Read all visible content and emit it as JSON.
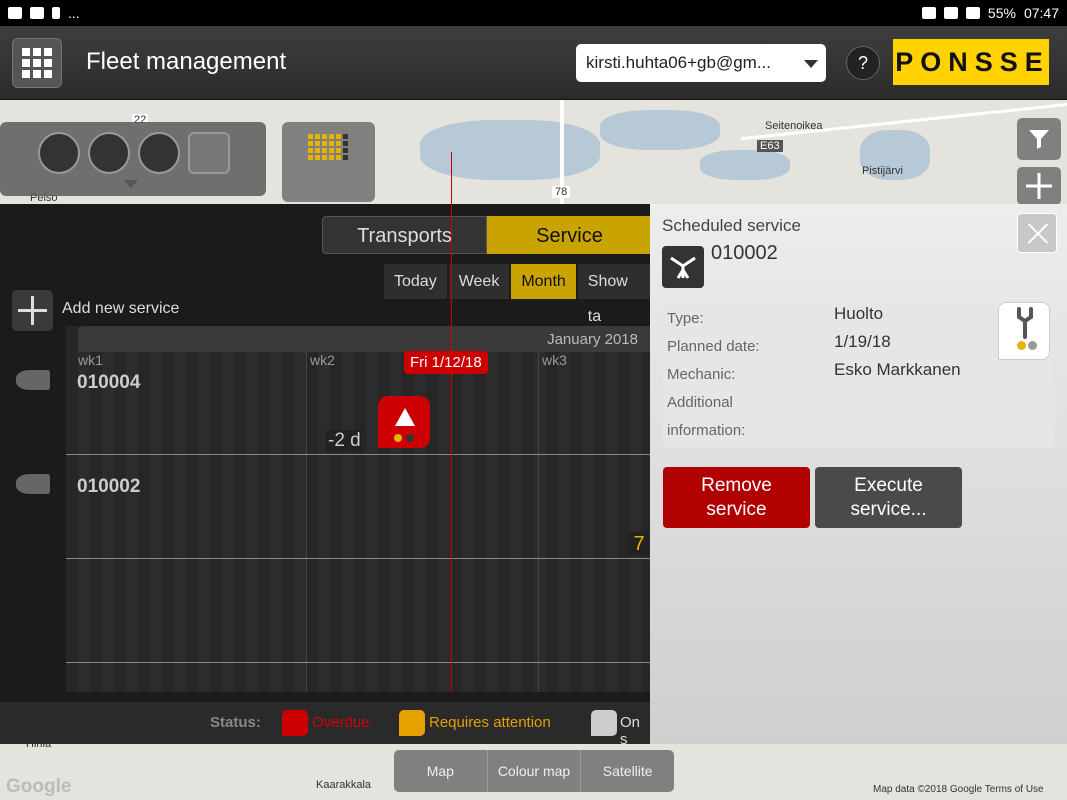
{
  "status_bar": {
    "ellipsis": "...",
    "battery": "55%",
    "time": "07:47"
  },
  "app": {
    "title": "Fleet management",
    "account": "kirsti.huhta06+gb@gm...",
    "help": "?",
    "logo_letters": [
      "P",
      "O",
      "N",
      "S",
      "S",
      "E"
    ]
  },
  "map": {
    "labels": {
      "pelso": "Pelso",
      "seitenoikea": "Seitenoikea",
      "e63": "E63",
      "pistijarvi": "Pistijärvi",
      "r78": "78",
      "r22": "22",
      "karakkala": "Kaarakkala",
      "hirila": "Hirilä"
    },
    "toggles": [
      "Map",
      "Colour map",
      "Satellite"
    ],
    "google": "Google",
    "attribution": "Map data ©2018 Google   Terms of Use"
  },
  "panel": {
    "mode_tabs": [
      "Transports",
      "Service"
    ],
    "range_tabs": [
      "Today",
      "Week",
      "Month",
      "Show ta"
    ],
    "add_label": "Add new service",
    "month": "January 2018",
    "weeks": [
      "wk1",
      "wk2",
      "wk3"
    ],
    "rows": [
      "010004",
      "010002"
    ],
    "today_tag": "Fri 1/12/18",
    "delta": "-2 d",
    "count": "7",
    "legend": {
      "label": "Status:",
      "overdue": "Overdue",
      "attention": "Requires attention",
      "on_schedule": "On s"
    }
  },
  "detail": {
    "title": "Scheduled service",
    "machine_id": "010002",
    "fields": {
      "type_label": "Type:",
      "type_value": "Huolto",
      "date_label": "Planned date:",
      "date_value": "1/19/18",
      "mechanic_label": "Mechanic:",
      "mechanic_value": "Esko Markkanen",
      "info_label_1": "Additional",
      "info_label_2": "information:"
    },
    "remove_1": "Remove",
    "remove_2": "service",
    "exec_1": "Execute",
    "exec_2": "service..."
  },
  "colors": {
    "accent": "#c9a300",
    "overdue": "#c00000",
    "logo": "#ffd200"
  }
}
